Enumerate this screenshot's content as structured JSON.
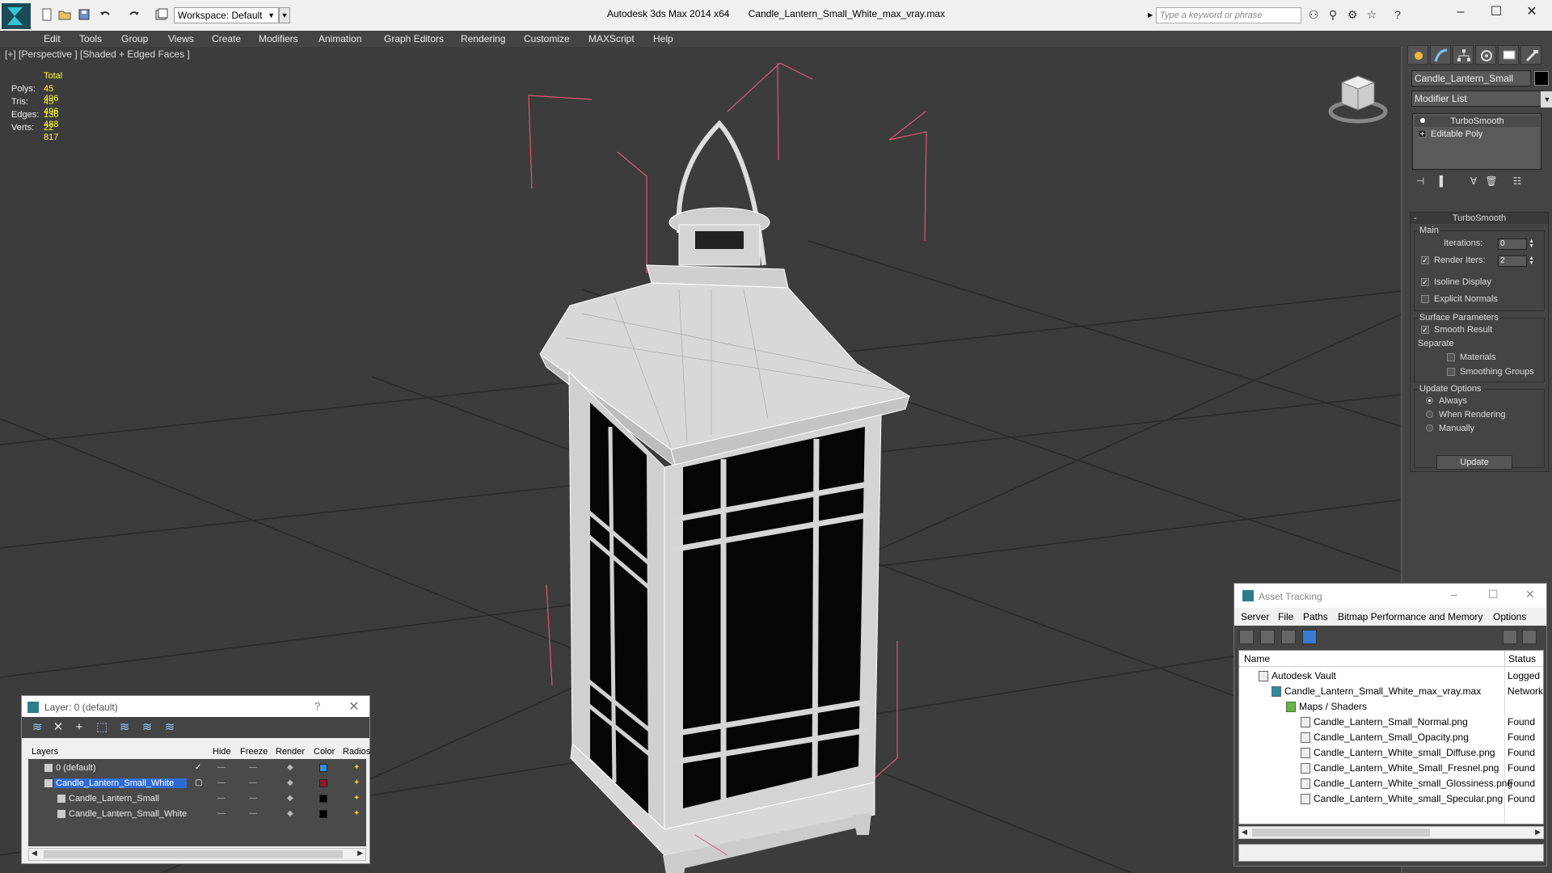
{
  "title_bar": {
    "workspace": "Workspace: Default",
    "app_name": "Autodesk 3ds Max  2014 x64",
    "file_name": "Candle_Lantern_Small_White_max_vray.max",
    "search_placeholder": "Type a keyword or phrase"
  },
  "menu": [
    "Edit",
    "Tools",
    "Group",
    "Views",
    "Create",
    "Modifiers",
    "Animation",
    "Graph Editors",
    "Rendering",
    "Customize",
    "MAXScript",
    "Help"
  ],
  "viewport": {
    "label": "[+] [Perspective ] [Shaded + Edged Faces ]",
    "stats_header": "Total",
    "stats": [
      {
        "key": "Polys:",
        "value": "45 496"
      },
      {
        "key": "Tris:",
        "value": "45 496"
      },
      {
        "key": "Edges:",
        "value": "136 488"
      },
      {
        "key": "Verts:",
        "value": "22 817"
      }
    ]
  },
  "command_panel": {
    "object_name": "Candle_Lantern_Small",
    "modifier_list": "Modifier List",
    "stack": [
      "TurboSmooth",
      "Editable Poly"
    ],
    "turbosmooth": {
      "header": "TurboSmooth",
      "main": "Main",
      "iterations_label": "Iterations:",
      "iterations_value": "0",
      "render_iters_label": "Render Iters:",
      "render_iters_value": "2",
      "isoline": "Isoline Display",
      "explicit_normals": "Explicit Normals",
      "surface_params": "Surface Parameters",
      "smooth_result": "Smooth Result",
      "separate": "Separate",
      "materials": "Materials",
      "smoothing_groups": "Smoothing Groups",
      "update_options": "Update Options",
      "always": "Always",
      "when_rendering": "When Rendering",
      "manually": "Manually",
      "update_button": "Update"
    }
  },
  "layer_dialog": {
    "title": "Layer: 0 (default)",
    "help": "?",
    "columns": [
      "Layers",
      "Hide",
      "Freeze",
      "Render",
      "Color",
      "Radios"
    ],
    "rows": [
      {
        "name": "0 (default)",
        "indent": 1,
        "color": "#3a8fe0"
      },
      {
        "name": "Candle_Lantern_Small_White",
        "indent": 1,
        "color": "#8b1a2a"
      },
      {
        "name": "Candle_Lantern_Small",
        "indent": 2,
        "color": "#000000"
      },
      {
        "name": "Candle_Lantern_Small_White",
        "indent": 2,
        "color": "#000000"
      }
    ]
  },
  "asset_tracking": {
    "title": "Asset Tracking",
    "menu": [
      "Server",
      "File",
      "Paths",
      "Bitmap Performance and Memory",
      "Options"
    ],
    "columns": [
      "Name",
      "Status"
    ],
    "rows": [
      {
        "name": "Autodesk Vault",
        "status": "Logged"
      },
      {
        "name": "Candle_Lantern_Small_White_max_vray.max",
        "status": "Network"
      },
      {
        "name": "Maps / Shaders",
        "status": ""
      },
      {
        "name": "Candle_Lantern_Small_Normal.png",
        "status": "Found"
      },
      {
        "name": "Candle_Lantern_Small_Opacity.png",
        "status": "Found"
      },
      {
        "name": "Candle_Lantern_White_small_Diffuse.png",
        "status": "Found"
      },
      {
        "name": "Candle_Lantern_White_Small_Fresnel.png",
        "status": "Found"
      },
      {
        "name": "Candle_Lantern_White_small_Glossiness.png",
        "status": "Found"
      },
      {
        "name": "Candle_Lantern_White_small_Specular.png",
        "status": "Found"
      }
    ]
  }
}
